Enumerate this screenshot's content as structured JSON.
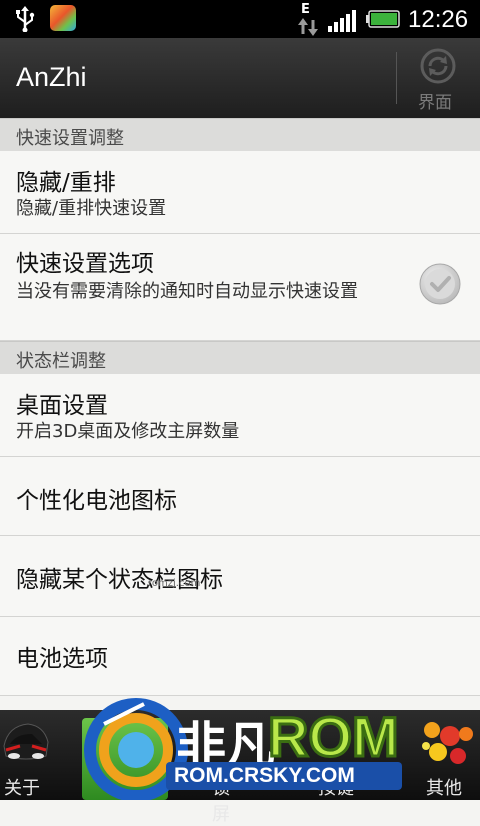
{
  "status_bar": {
    "network_type": "E",
    "time": "12:26"
  },
  "action_bar": {
    "title": "AnZhi",
    "action_label": "界面"
  },
  "sections": [
    {
      "header": "快速设置调整",
      "items": [
        {
          "title": "隐藏/重排",
          "summary": "隐藏/重排快速设置"
        },
        {
          "title": "快速设置选项",
          "summary": "当没有需要清除的通知时自动显示快速设置",
          "checked": false
        }
      ]
    },
    {
      "header": "状态栏调整",
      "items": [
        {
          "title": "桌面设置",
          "summary": "开启3D桌面及修改主屏数量"
        },
        {
          "title": "个性化电池图标"
        },
        {
          "title": "隐藏某个状态栏图标"
        },
        {
          "title": "电池选项"
        }
      ]
    }
  ],
  "watermark_small": "romzj.com",
  "bottom_tabs": [
    {
      "label": "关于",
      "icon": "sports-car-icon"
    },
    {
      "label": "锁屏",
      "icon": "lock-screen-icon"
    },
    {
      "label": "按键",
      "icon": "keys-icon"
    },
    {
      "label": "其他",
      "icon": "paint-palette-icon"
    }
  ],
  "watermark": {
    "brand": "非凡",
    "rom": "ROM",
    "url": "ROM.CRSKY.COM"
  },
  "colors": {
    "action_bar": "#262626",
    "section_header": "#dcdcda",
    "list_background": "#f7f7f5",
    "watermark_rom": "#b9e84a",
    "watermark_url_bg": "#1a4fa8"
  }
}
